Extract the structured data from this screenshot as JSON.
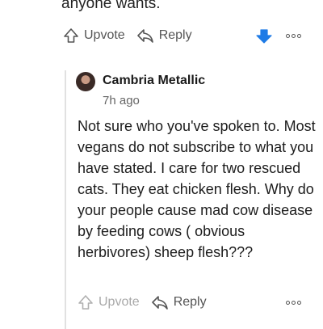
{
  "parent_comment": {
    "text_tail": "anyone wants.",
    "actions": {
      "upvote_label": "Upvote",
      "reply_label": "Reply"
    },
    "vote_state": "downvoted",
    "accent_color": "#1e7be6"
  },
  "reply_comment": {
    "author": "Cambria Metallic",
    "timestamp": "7h ago",
    "body": "Not sure who you've spoken to. Most vegans do not subscribe to what you have stated. I care for two rescued cats. They eat chicken flesh. Why do your people cause mad cow disease by feeding cows ( obvious herbivores) sheep flesh???",
    "actions": {
      "upvote_label": "Upvote",
      "reply_label": "Reply"
    },
    "upvote_state": "disabled"
  },
  "icons": [
    "upvote-arrow-icon",
    "reply-arrow-icon",
    "downvote-arrow-icon",
    "more-options-icon",
    "avatar"
  ]
}
